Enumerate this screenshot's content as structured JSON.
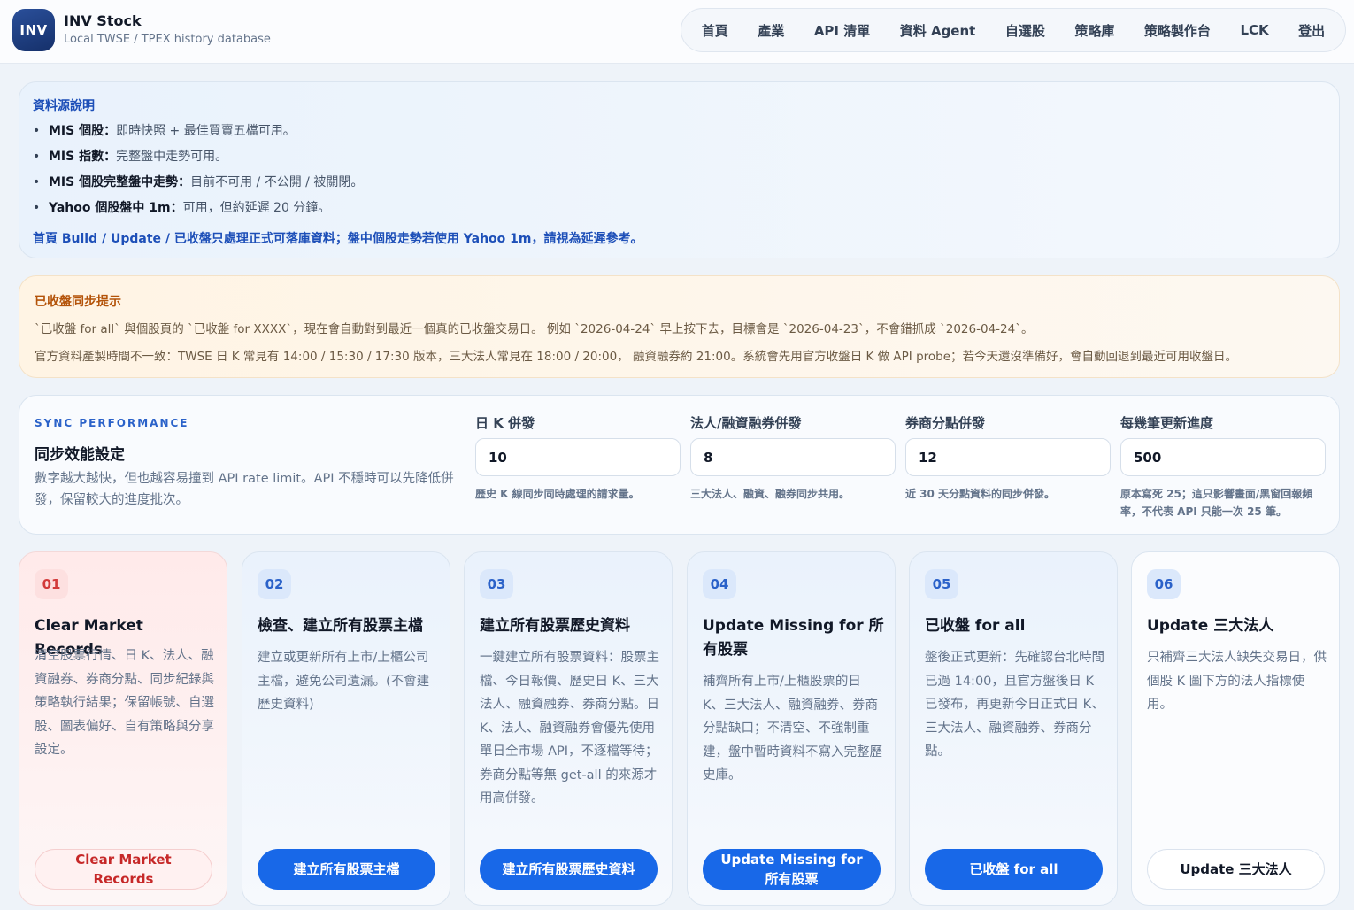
{
  "header": {
    "logo": "INV",
    "title": "INV Stock",
    "subtitle": "Local TWSE / TPEX history database",
    "nav": [
      "首頁",
      "產業",
      "API 清單",
      "資料 Agent",
      "自選股",
      "策略庫",
      "策略製作台",
      "LCK",
      "登出"
    ]
  },
  "info": {
    "title": "資料源說明",
    "items": [
      {
        "bold": "MIS 個股：",
        "text": "即時快照 + 最佳買賣五檔可用。"
      },
      {
        "bold": "MIS 指數：",
        "text": "完整盤中走勢可用。"
      },
      {
        "bold": "MIS 個股完整盤中走勢：",
        "text": "目前不可用 / 不公開 / 被關閉。"
      },
      {
        "bold": "Yahoo 個股盤中 1m：",
        "text": "可用，但約延遲 20 分鐘。"
      }
    ],
    "footer": "首頁 Build / Update / 已收盤只處理正式可落庫資料；盤中個股走勢若使用 Yahoo 1m，請視為延遲參考。"
  },
  "warning": {
    "title": "已收盤同步提示",
    "line1": "`已收盤 for all` 與個股頁的 `已收盤 for XXXX`，現在會自動對到最近一個真的已收盤交易日。 例如 `2026-04-24` 早上按下去，目標會是 `2026-04-23`，不會錯抓成 `2026-04-24`。",
    "line2": "官方資料產製時間不一致：TWSE 日 K 常見有 14:00 / 15:30 / 17:30 版本，三大法人常見在 18:00 / 20:00， 融資融券約 21:00。系統會先用官方收盤日 K 做 API probe；若今天還沒準備好，會自動回退到最近可用收盤日。"
  },
  "sync": {
    "kicker": "SYNC PERFORMANCE",
    "title": "同步效能設定",
    "desc": "數字越大越快，但也越容易撞到 API rate limit。API 不穩時可以先降低併發，保留較大的進度批次。",
    "fields": [
      {
        "label": "日 K 併發",
        "value": "10",
        "hint": "歷史 K 線同步同時處理的請求量。"
      },
      {
        "label": "法人/融資融券併發",
        "value": "8",
        "hint": "三大法人、融資、融券同步共用。"
      },
      {
        "label": "券商分點併發",
        "value": "12",
        "hint": "近 30 天分點資料的同步併發。"
      },
      {
        "label": "每幾筆更新進度",
        "value": "500",
        "hint": "原本寫死 25；這只影響畫面/黑窗回報頻率，不代表 API 只能一次 25 筆。"
      }
    ]
  },
  "cards": [
    {
      "num": "01",
      "title": "Clear Market Records",
      "desc": "清空股票行情、日 K、法人、融資融券、券商分點、同步紀錄與策略執行結果；保留帳號、自選股、圖表偏好、自有策略與分享設定。",
      "button": "Clear Market Records"
    },
    {
      "num": "02",
      "title": "檢查、建立所有股票主檔",
      "desc": "建立或更新所有上市/上櫃公司主檔，避免公司遺漏。(不會建歷史資料)",
      "button": "建立所有股票主檔"
    },
    {
      "num": "03",
      "title": "建立所有股票歷史資料",
      "desc": "一鍵建立所有股票資料：股票主檔、今日報價、歷史日 K、三大法人、融資融券、券商分點。日 K、法人、融資融券會優先使用單日全市場 API，不逐檔等待；券商分點等無 get-all 的來源才用高併發。",
      "button": "建立所有股票歷史資料"
    },
    {
      "num": "04",
      "title": "Update Missing for 所有股票",
      "desc": "補齊所有上市/上櫃股票的日 K、三大法人、融資融券、券商分點缺口；不清空、不強制重建，盤中暫時資料不寫入完整歷史庫。",
      "button": "Update Missing for 所有股票"
    },
    {
      "num": "05",
      "title": "已收盤 for all",
      "desc": "盤後正式更新：先確認台北時間已過 14:00，且官方盤後日 K 已發布，再更新今日正式日 K、三大法人、融資融券、券商分點。",
      "button": "已收盤 for all"
    },
    {
      "num": "06",
      "title": "Update 三大法人",
      "desc": "只補齊三大法人缺失交易日，供個股 K 圖下方的法人指標使用。",
      "button": "Update 三大法人"
    }
  ]
}
